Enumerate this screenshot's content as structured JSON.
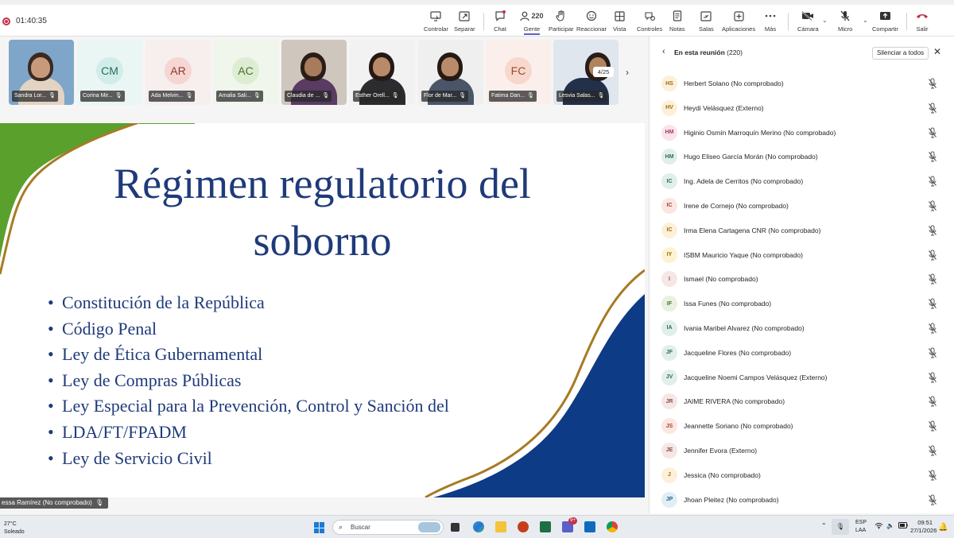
{
  "meeting": {
    "timer": "01:40:35"
  },
  "toolbar": {
    "items": [
      {
        "label": "Controlar"
      },
      {
        "label": "Separar"
      },
      {
        "label": "Chat"
      },
      {
        "label": "Gente",
        "count": "220"
      },
      {
        "label": "Participar"
      },
      {
        "label": "Reaccionar"
      },
      {
        "label": "Vista"
      },
      {
        "label": "Controles"
      },
      {
        "label": "Notas"
      },
      {
        "label": "Salas"
      },
      {
        "label": "Aplicaciones"
      },
      {
        "label": "Más"
      },
      {
        "label": "Cámara"
      },
      {
        "label": "Micro"
      },
      {
        "label": "Compartir"
      },
      {
        "label": "Salir"
      }
    ]
  },
  "strip": {
    "tiles": [
      {
        "name": "Sandra Lor...",
        "type": "photo"
      },
      {
        "name": "Corina Mir...",
        "initials": "CM",
        "bg": "#e3f4f2",
        "avatar_bg": "#d0ede9"
      },
      {
        "name": "Ada Melvin...",
        "initials": "AR",
        "bg": "#f9ecec",
        "avatar_bg": "#f6d6d2"
      },
      {
        "name": "Amalia Sali...",
        "initials": "AC",
        "bg": "#eef5e9",
        "avatar_bg": "#dcedd2"
      },
      {
        "name": "Claudia de ...",
        "type": "photo"
      },
      {
        "name": "Esther Orell...",
        "type": "photo"
      },
      {
        "name": "Flor de Mar...",
        "type": "photo"
      },
      {
        "name": "Fatima Dan...",
        "initials": "FC",
        "bg": "#fbece7",
        "avatar_bg": "#f8d7cc"
      },
      {
        "name": "Lesvia Salas...",
        "type": "photo"
      }
    ],
    "page": "4/25"
  },
  "slide": {
    "title_line1": "Régimen regulatorio del",
    "title_line2": "soborno",
    "bullets": [
      "Constitución de la República",
      "Código Penal",
      "Ley de Ética Gubernamental",
      "Ley de Compras Públicas",
      "Ley Especial para la Prevención, Control y Sanción del",
      "LDA/FT/FPADM",
      "Ley de Servicio Civil"
    ],
    "colors": {
      "navy": "#1f3a7a",
      "green": "#5aa02c",
      "gold": "#a77b25"
    }
  },
  "speaker_label": "essa Ramírez (No comprobado)",
  "panel": {
    "title": "En esta reunión",
    "count": "(220)",
    "mute_all": "Silenciar a todos",
    "participants": [
      {
        "initials": "HS",
        "name": "Herbert Solano (No comprobado)",
        "bg": "#fdf0d8",
        "fg": "#9a6b12"
      },
      {
        "initials": "HV",
        "name": "Heydi Velásquez (Externo)",
        "bg": "#fdf0d8",
        "fg": "#9a6b12"
      },
      {
        "initials": "HM",
        "name": "Higinio Osmín Marroquín Merino (No comprobado)",
        "bg": "#fbe3ea",
        "fg": "#a63b5b"
      },
      {
        "initials": "HM",
        "name": "Hugo Eliseo García Morán (No comprobado)",
        "bg": "#e1efe9",
        "fg": "#2e6b52"
      },
      {
        "initials": "IC",
        "name": "Ing. Adela de Cerritos (No comprobado)",
        "bg": "#e1efe9",
        "fg": "#2e6b52"
      },
      {
        "initials": "IC",
        "name": "Irene de Cornejo (No comprobado)",
        "bg": "#fbe6e2",
        "fg": "#a5412e"
      },
      {
        "initials": "IC",
        "name": "Irma Elena Cartagena CNR (No comprobado)",
        "bg": "#fdf0d8",
        "fg": "#9a6b12"
      },
      {
        "initials": "IY",
        "name": "ISBM Mauricio Yaque (No comprobado)",
        "bg": "#fdf3d3",
        "fg": "#8d6a0a"
      },
      {
        "initials": "I",
        "name": "Ismael (No comprobado)",
        "bg": "#f4e7e5",
        "fg": "#8a4a42"
      },
      {
        "initials": "IF",
        "name": "Issa Funes (No comprobado)",
        "bg": "#e8f0e0",
        "fg": "#4b6e2c"
      },
      {
        "initials": "IA",
        "name": "Ivania Maribel Alvarez (No comprobado)",
        "bg": "#e1efe9",
        "fg": "#2e6b52"
      },
      {
        "initials": "JF",
        "name": "Jacqueline Flores (No comprobado)",
        "bg": "#e1efe9",
        "fg": "#2e6b52"
      },
      {
        "initials": "JV",
        "name": "Jacqueline Noemi Campos Velásquez (Externo)",
        "bg": "#e1efe9",
        "fg": "#2e6b52"
      },
      {
        "initials": "JR",
        "name": "JAIME RIVERA (No comprobado)",
        "bg": "#f4e7e5",
        "fg": "#8a4a42"
      },
      {
        "initials": "JS",
        "name": "Jeannette Soriano (No comprobado)",
        "bg": "#fbe6e2",
        "fg": "#a5412e"
      },
      {
        "initials": "JE",
        "name": "Jennifer Evora (Externo)",
        "bg": "#f4e7e5",
        "fg": "#8a4a42"
      },
      {
        "initials": "J",
        "name": "Jessica (No comprobado)",
        "bg": "#fdf0d8",
        "fg": "#9a6b12"
      },
      {
        "initials": "JP",
        "name": "Jhoan Pleitez (No comprobado)",
        "bg": "#e0eef6",
        "fg": "#2d6384"
      }
    ]
  },
  "taskbar": {
    "weather_temp": "27°C",
    "weather_desc": "Soleado",
    "search_placeholder": "Buscar",
    "lang_line1": "ESP",
    "lang_line2": "LAA",
    "time": "09:51",
    "date": "27/1/2026",
    "teams_badge": "9+"
  }
}
